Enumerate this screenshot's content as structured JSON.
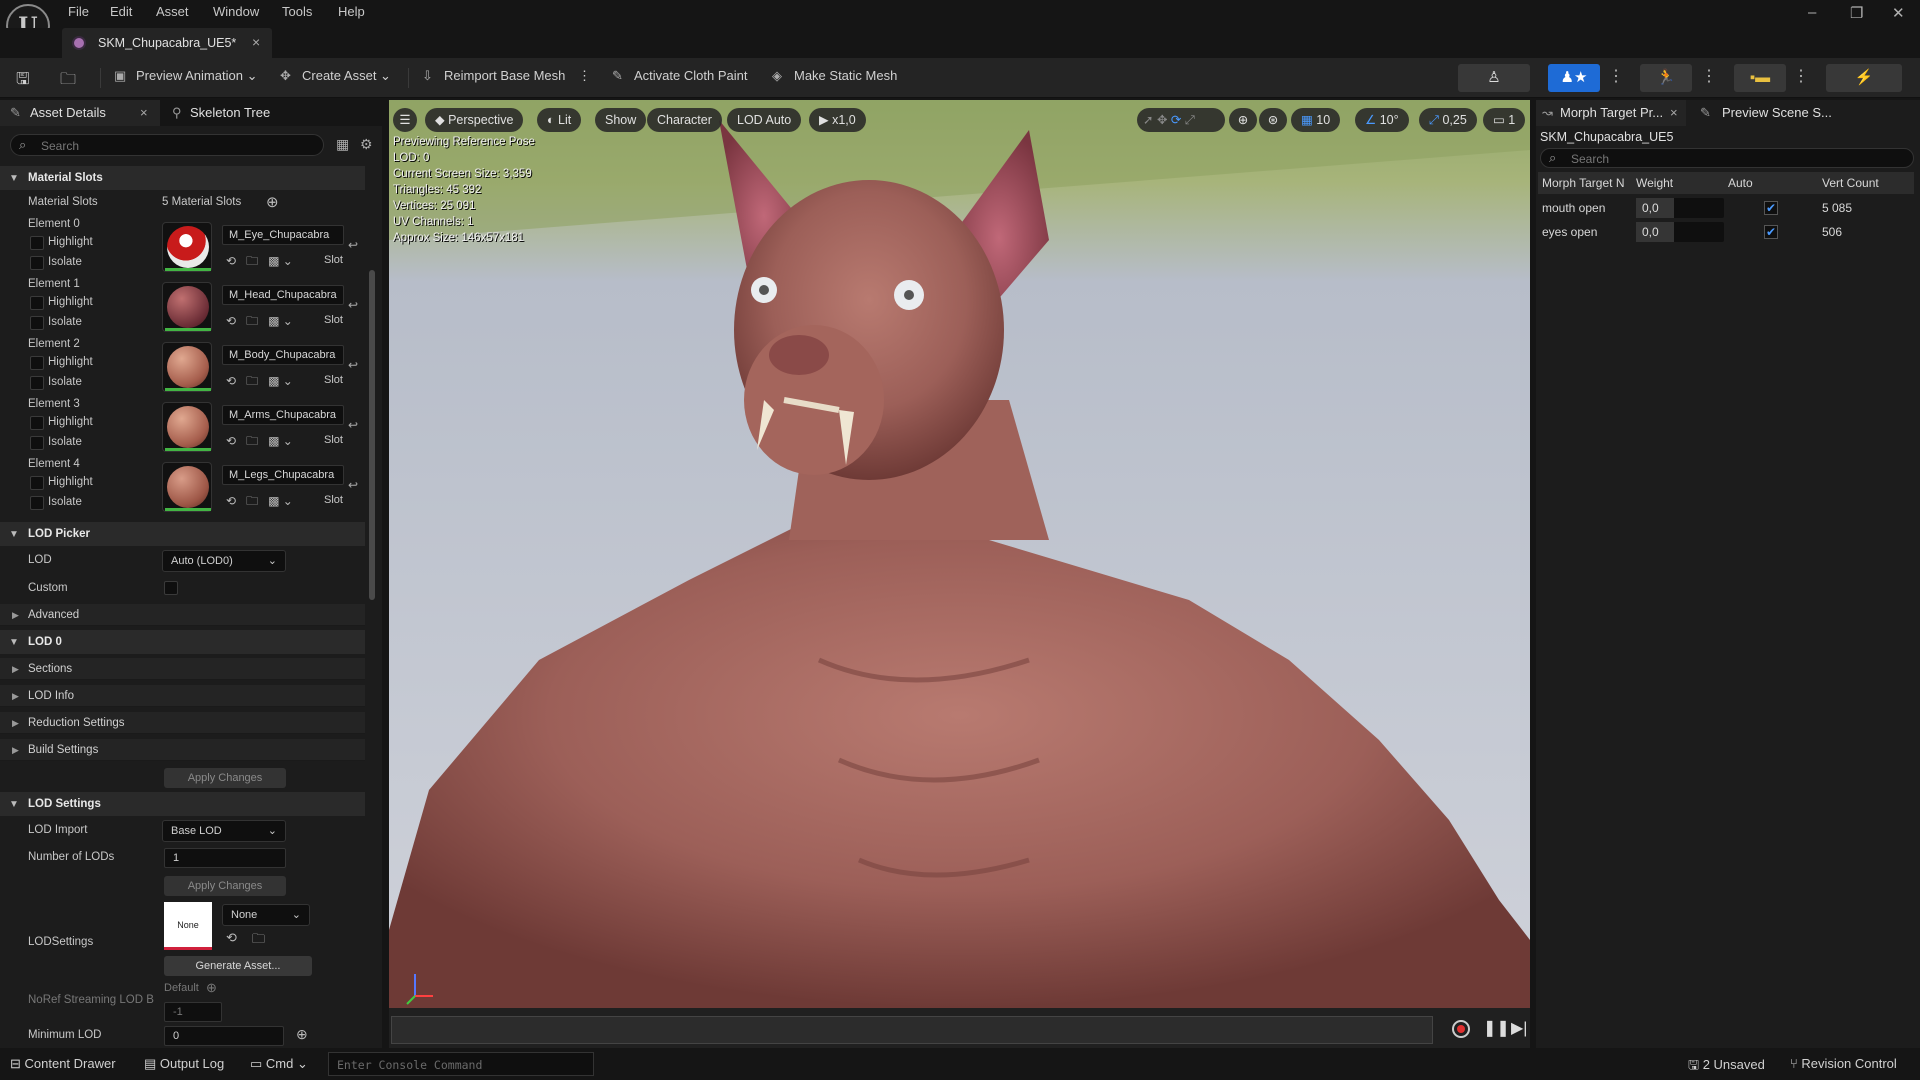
{
  "menu": {
    "items": [
      "File",
      "Edit",
      "Asset",
      "Window",
      "Tools",
      "Help"
    ],
    "logo": "U"
  },
  "window_controls": {
    "minimize": "–",
    "restore": "❐",
    "close": "✕"
  },
  "doc_tab": {
    "title": "SKM_Chupacabra_UE5*",
    "close": "×"
  },
  "toolbar": {
    "preview_animation": "Preview Animation",
    "create_asset": "Create Asset",
    "reimport": "Reimport Base Mesh",
    "cloth_paint": "Activate Cloth Paint",
    "static_mesh": "Make Static Mesh"
  },
  "left": {
    "tab_details": "Asset Details",
    "tab_skeleton": "Skeleton Tree",
    "search_placeholder": "Search",
    "material_slots": {
      "header": "Material Slots",
      "label": "Material Slots",
      "count": "5 Material Slots",
      "highlight": "Highlight",
      "isolate": "Isolate",
      "slot": "Slot",
      "elements": [
        {
          "name": "Element 0",
          "material": "M_Eye_Chupacabra"
        },
        {
          "name": "Element 1",
          "material": "M_Head_Chupacabra"
        },
        {
          "name": "Element 2",
          "material": "M_Body_Chupacabra"
        },
        {
          "name": "Element 3",
          "material": "M_Arms_Chupacabra"
        },
        {
          "name": "Element 4",
          "material": "M_Legs_Chupacabra"
        }
      ]
    },
    "lod_picker": {
      "header": "LOD Picker",
      "lod_label": "LOD",
      "lod_value": "Auto (LOD0)",
      "custom_label": "Custom",
      "advanced": "Advanced"
    },
    "lod0": {
      "header": "LOD 0",
      "sections": "Sections",
      "lod_info": "LOD Info",
      "reduction": "Reduction Settings",
      "build": "Build Settings",
      "apply": "Apply Changes"
    },
    "lod_settings": {
      "header": "LOD Settings",
      "import_label": "LOD Import",
      "import_value": "Base LOD",
      "num_label": "Number of LODs",
      "num_value": "1",
      "apply": "Apply Changes",
      "lodsettings_label": "LODSettings",
      "thumb_none": "None",
      "asset_value": "None",
      "generate": "Generate Asset...",
      "noref_label": "NoRef Streaming LOD B",
      "default_label": "Default",
      "noref_value": "-1",
      "min_label": "Minimum LOD",
      "min_value": "0"
    }
  },
  "viewport": {
    "perspective": "Perspective",
    "lit": "Lit",
    "show": "Show",
    "character": "Character",
    "lod": "LOD Auto",
    "speed": "x1,0",
    "grid": "10",
    "angle": "10°",
    "scale": "0,25",
    "camera": "1",
    "stats": [
      "Previewing Reference Pose",
      "LOD: 0",
      "Current Screen Size: 3,359",
      "Triangles: 45 392",
      "Vertices: 25 091",
      "UV Channels: 1",
      "Approx Size: 146x57x181"
    ]
  },
  "right": {
    "tab_morph": "Morph Target Pr...",
    "tab_scene": "Preview Scene S...",
    "asset_name": "SKM_Chupacabra_UE5",
    "search_placeholder": "Search",
    "columns": [
      "Morph Target N",
      "Weight",
      "Auto",
      "Vert Count"
    ],
    "rows": [
      {
        "name": "mouth open",
        "weight": "0,0",
        "auto": true,
        "verts": "5 085"
      },
      {
        "name": "eyes open",
        "weight": "0,0",
        "auto": true,
        "verts": "506"
      }
    ]
  },
  "statusbar": {
    "content_drawer": "Content Drawer",
    "output_log": "Output Log",
    "cmd": "Cmd",
    "console_placeholder": "Enter Console Command",
    "unsaved": "2 Unsaved",
    "revision": "Revision Control"
  },
  "colors": {
    "accent": "#1e6bd6",
    "panel": "#1c1c1c",
    "bg": "#151515",
    "material_ok": "#43b544"
  }
}
